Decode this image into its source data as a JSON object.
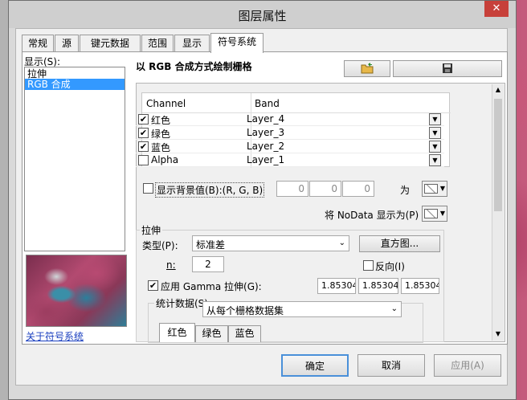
{
  "window": {
    "title": "图层属性",
    "close": "✕"
  },
  "tabs": [
    "常规",
    "源",
    "键元数据",
    "范围",
    "显示",
    "符号系统"
  ],
  "left": {
    "show_label": "显示(S):",
    "items": [
      "拉伸",
      "RGB 合成"
    ],
    "about_link": "关于符号系统"
  },
  "main": {
    "heading": "以 RGB 合成方式绘制栅格",
    "table": {
      "headers": [
        "Channel",
        "Band"
      ],
      "rows": [
        {
          "channel": "红色",
          "band": "Layer_4",
          "checked": true
        },
        {
          "channel": "绿色",
          "band": "Layer_3",
          "checked": true
        },
        {
          "channel": "蓝色",
          "band": "Layer_2",
          "checked": true
        },
        {
          "channel": "Alpha",
          "band": "Layer_1",
          "checked": false
        }
      ]
    },
    "background": {
      "label": "显示背景值(B):(R, G, B)",
      "r": "0",
      "g": "0",
      "b": "0",
      "as_label": "为"
    },
    "nodata_label": "将 NoData 显示为(P)",
    "stretch": {
      "group": "拉伸",
      "type_label": "类型(P):",
      "type_value": "标准差",
      "histogram_button": "直方图...",
      "n_label": "n:",
      "n_value": "2",
      "invert_label": "反向(I)",
      "gamma_label": "应用 Gamma 拉伸(G):",
      "gamma": [
        "1.85304",
        "1.85304",
        "1.85304"
      ],
      "stats_label": "统计数据(S)",
      "stats_value": "从每个栅格数据集",
      "subtabs": [
        "红色",
        "绿色",
        "蓝色"
      ]
    }
  },
  "footer": {
    "ok": "确定",
    "cancel": "取消",
    "apply": "应用(A)"
  },
  "colors": {
    "selection": "#3399ff",
    "accent_border": "#4a90d9"
  }
}
